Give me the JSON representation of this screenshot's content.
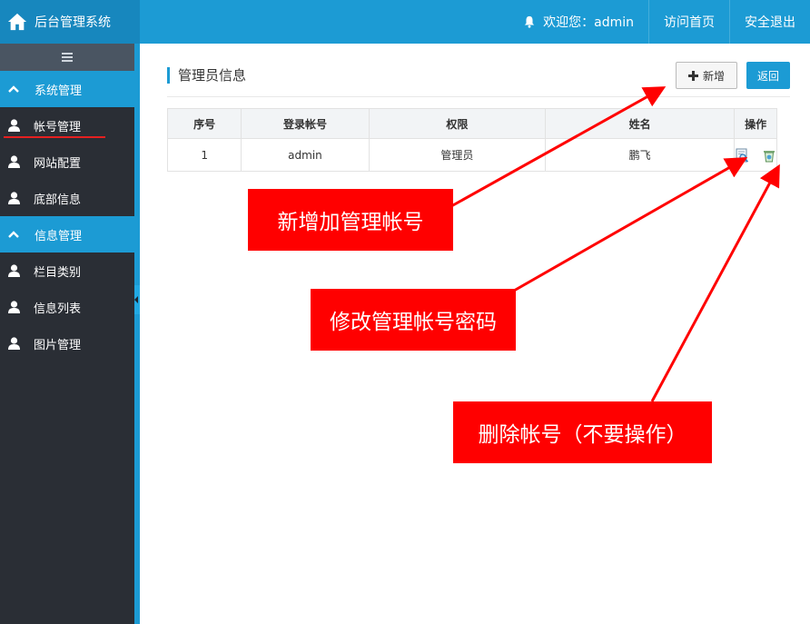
{
  "header": {
    "app_title": "后台管理系统",
    "welcome": "欢迎您：admin",
    "visit_home": "访问首页",
    "logout": "安全退出"
  },
  "sidebar": {
    "groups": [
      {
        "label": "系统管理",
        "items": [
          {
            "label": "帐号管理",
            "active": true
          },
          {
            "label": "网站配置"
          },
          {
            "label": "底部信息"
          }
        ]
      },
      {
        "label": "信息管理",
        "items": [
          {
            "label": "栏目类别"
          },
          {
            "label": "信息列表"
          },
          {
            "label": "图片管理"
          }
        ]
      }
    ]
  },
  "main": {
    "title": "管理员信息",
    "add_button": "新增",
    "back_button": "返回",
    "table": {
      "columns": [
        "序号",
        "登录帐号",
        "权限",
        "姓名",
        "操作"
      ],
      "rows": [
        {
          "index": "1",
          "account": "admin",
          "role": "管理员",
          "name": "鹏飞"
        }
      ]
    }
  },
  "annotations": {
    "add": "新增加管理帐号",
    "edit": "修改管理帐号密码",
    "delete": "删除帐号（不要操作）"
  },
  "colors": {
    "primary": "#1c9bd4",
    "sidebar_bg": "#2a2e35",
    "callout_red": "#ff0000"
  },
  "icons": [
    "home-icon",
    "bell-icon",
    "hamburger-icon",
    "chevron-up-icon",
    "user-icon",
    "plus-icon",
    "edit-icon",
    "delete-icon"
  ]
}
